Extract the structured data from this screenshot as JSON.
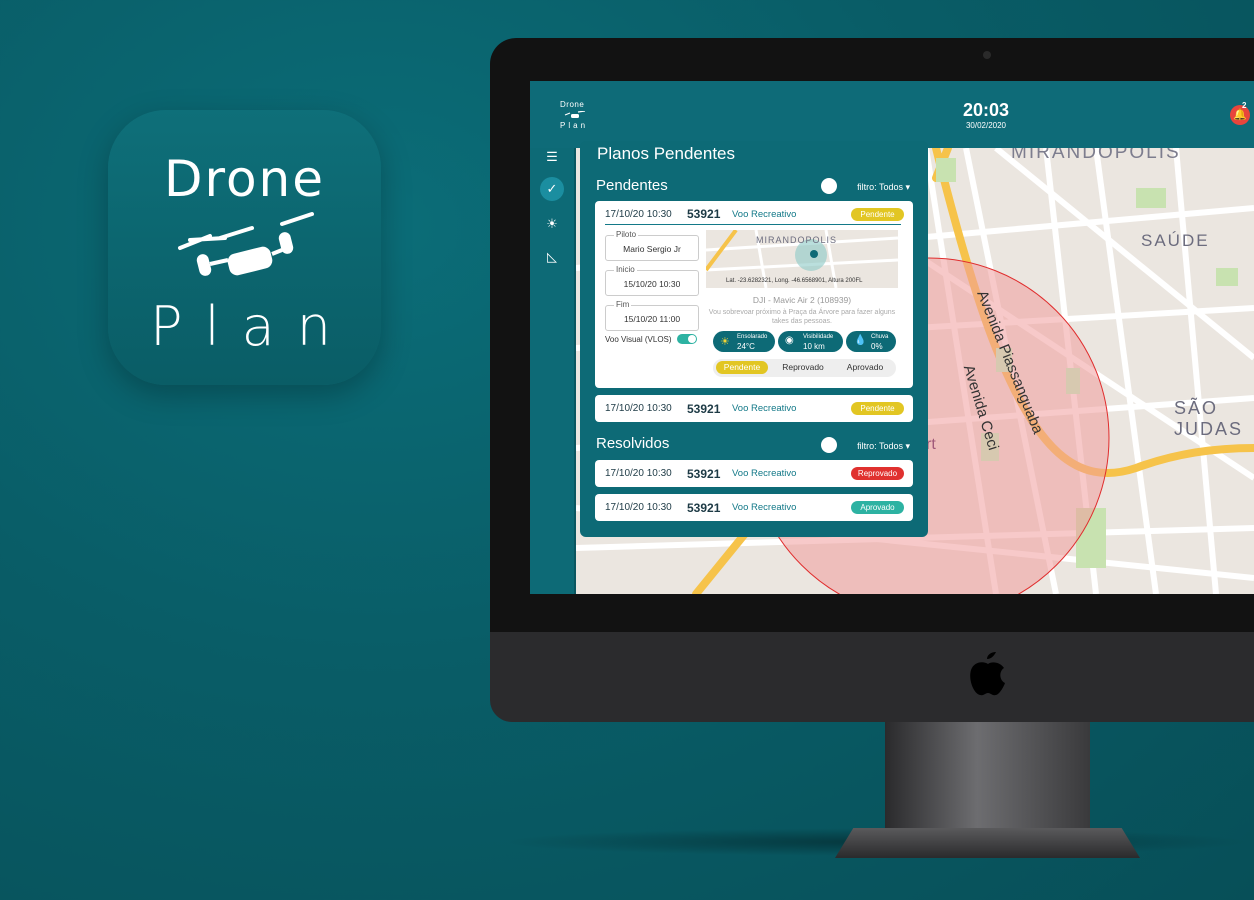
{
  "icon": {
    "line1": "Drone",
    "line2": "Plan"
  },
  "header": {
    "logo_line1": "Drone",
    "logo_line2": "Plan",
    "time": "20:03",
    "date": "30/02/2020",
    "notifications": "2"
  },
  "sidebar": {
    "icons": [
      "list-icon",
      "check-icon",
      "sun-icon",
      "ruler-icon"
    ]
  },
  "map": {
    "labels": {
      "mirandopolis": "MIRANDÓPOLIS",
      "saude": "SAÚDE",
      "sao_judas": "SÃO JUDAS",
      "av_piassanguaba": "Avenida Piassanguaba",
      "av_ceci": "Avenida Ceci",
      "fragment": "rt"
    }
  },
  "panel": {
    "title": "Planos Pendentes",
    "pending_section": "Pendentes",
    "resolved_section": "Resolvidos",
    "filter": "filtro: Todos ▾",
    "expanded": {
      "date": "17/10/20 10:30",
      "number": "53921",
      "type": "Voo Recreativo",
      "status": "Pendente",
      "pilot_label": "Piloto",
      "pilot": "Mario Sergio Jr",
      "start_label": "Inicio",
      "start": "15/10/20 10:30",
      "end_label": "Fim",
      "end": "15/10/20 11:00",
      "vlos_label": "Voo Visual (VLOS)",
      "map_label": "MIRANDOPOLIS",
      "coords": "Lat. -23.6282321, Long. -46.6568901, Altura 200FL",
      "drone": "DJI - Mavic Air 2 (108939)",
      "description": "Vou sobrevoar próximo à Praça da Árvore para fazer alguns takes das pessoas.",
      "weather": [
        {
          "label": "Ensolarado",
          "value": "24°C"
        },
        {
          "label": "Visibilidade",
          "value": "10 km"
        },
        {
          "label": "Chuva",
          "value": "0%"
        }
      ],
      "segments": [
        "Pendente",
        "Reprovado",
        "Aprovado"
      ]
    },
    "pending_rows": [
      {
        "date": "17/10/20 10:30",
        "number": "53921",
        "type": "Voo Recreativo",
        "status": "Pendente"
      }
    ],
    "resolved_rows": [
      {
        "date": "17/10/20 10:30",
        "number": "53921",
        "type": "Voo Recreativo",
        "status": "Reprovado"
      },
      {
        "date": "17/10/20 10:30",
        "number": "53921",
        "type": "Voo Recreativo",
        "status": "Aprovado"
      }
    ]
  },
  "colors": {
    "brand": "#0d6a76",
    "pending": "#e2c623",
    "rejected": "#e0312f",
    "approved": "#2db2a2"
  }
}
